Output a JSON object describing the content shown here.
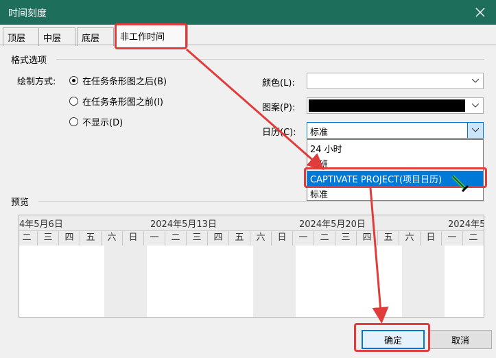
{
  "dialog": {
    "title": "时间刻度"
  },
  "tabs": [
    {
      "label": "顶层"
    },
    {
      "label": "中层"
    },
    {
      "label": "底层"
    },
    {
      "label": "非工作时间"
    }
  ],
  "format_options": {
    "group_label": "格式选项",
    "draw_label": "绘制方式:",
    "radios": [
      {
        "label": "在任务条形图之后(B)",
        "checked": true
      },
      {
        "label": "在任务条形图之前(I)",
        "checked": false
      },
      {
        "label": "不显示(D)",
        "checked": false
      }
    ],
    "color_label": "颜色(L):",
    "pattern_label": "图案(P):",
    "calendar_label": "日历(C):",
    "calendar_value": "标准",
    "pattern_color": "#000000",
    "calendar_options": [
      {
        "label": "24 小时"
      },
      {
        "label": "夜班"
      },
      {
        "label": "CAPTIVATE PROJECT(项目日历)",
        "selected": true
      },
      {
        "label": "标准"
      }
    ]
  },
  "preview": {
    "group_label": "预览",
    "weeks": [
      "4年5月6日",
      "2024年5月13日",
      "2024年5月20日",
      "2024年5"
    ],
    "days": [
      "二",
      "三",
      "四",
      "五",
      "六",
      "日",
      "一",
      "二",
      "三",
      "四",
      "五",
      "六",
      "日",
      "一",
      "二",
      "三",
      "四",
      "五",
      "六",
      "日",
      "一",
      "二"
    ]
  },
  "buttons": {
    "ok": "确定",
    "cancel": "取消"
  },
  "colors": {
    "titlebar": "#1e6e5c",
    "highlight": "#e03c3c",
    "selection": "#0078d7"
  }
}
